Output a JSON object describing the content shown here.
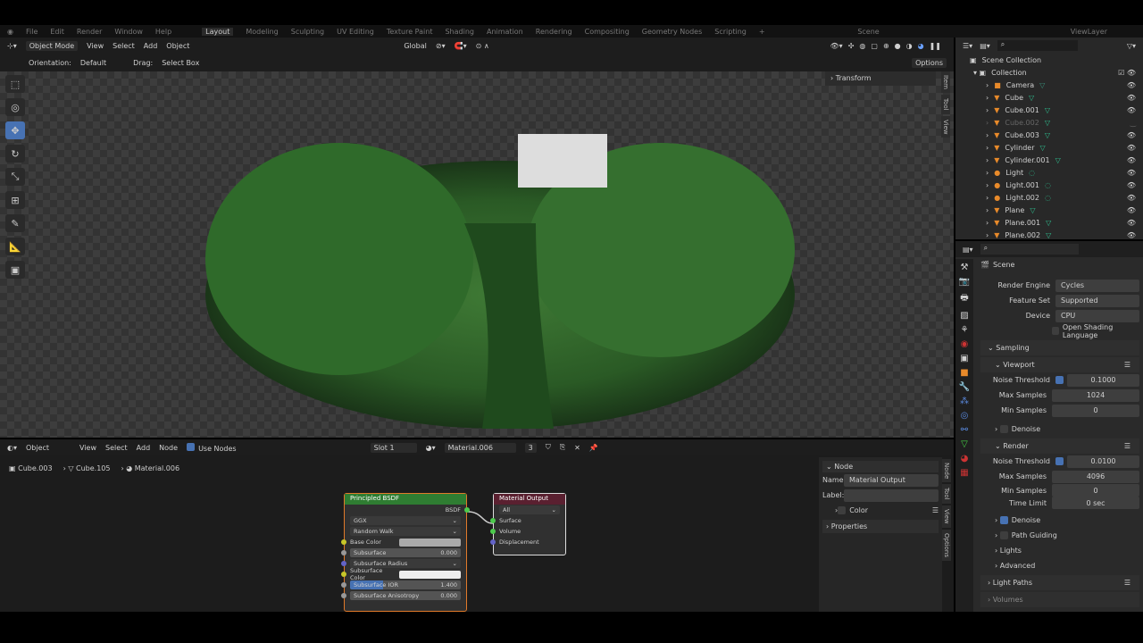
{
  "menu": [
    "File",
    "Edit",
    "Render",
    "Window",
    "Help"
  ],
  "workspaces": [
    "Layout",
    "Modeling",
    "Sculpting",
    "UV Editing",
    "Texture Paint",
    "Shading",
    "Animation",
    "Rendering",
    "Compositing",
    "Geometry Nodes",
    "Scripting"
  ],
  "scene": "Scene",
  "view_layer": "ViewLayer",
  "viewport_header": {
    "mode": "Object Mode",
    "view": "View",
    "select": "Select",
    "add": "Add",
    "object": "Object",
    "transform": "Global",
    "options": "Options"
  },
  "tool_settings": {
    "orientation_label": "Orientation:",
    "orientation": "Default",
    "drag_label": "Drag:",
    "drag": "Select Box"
  },
  "n_panel": {
    "transform": "Transform",
    "tabs": [
      "Item",
      "Tool",
      "View"
    ]
  },
  "node_header": {
    "editor": "Object",
    "view": "View",
    "select": "Select",
    "add": "Add",
    "node": "Node",
    "use_nodes": "Use Nodes",
    "slot": "Slot 1",
    "material": "Material.006",
    "users": "3"
  },
  "breadcrumb": [
    "Cube.003",
    "Cube.105",
    "Material.006"
  ],
  "principled": {
    "title": "Principled BSDF",
    "output": "BSDF",
    "distribution": "GGX",
    "sss_method": "Random Walk",
    "rows": [
      {
        "label": "Base Color"
      },
      {
        "label": "Subsurface",
        "value": "0.000"
      },
      {
        "label": "Subsurface Radius"
      },
      {
        "label": "Subsurface Color"
      },
      {
        "label": "Subsurface IOR",
        "value": "1.400"
      },
      {
        "label": "Subsurface Anisotropy",
        "value": "0.000"
      }
    ]
  },
  "material_output": {
    "title": "Material Output",
    "target": "All",
    "inputs": [
      "Surface",
      "Volume",
      "Displacement"
    ]
  },
  "node_side": {
    "section": "Node",
    "name_label": "Name:",
    "name": "Material Output",
    "label_label": "Label:",
    "color": "Color",
    "properties": "Properties",
    "tabs": [
      "Node",
      "Tool",
      "View",
      "Options"
    ]
  },
  "outliner": {
    "scene_collection": "Scene Collection",
    "collection": "Collection",
    "items": [
      {
        "name": "Camera",
        "type": "camera"
      },
      {
        "name": "Cube",
        "type": "mesh"
      },
      {
        "name": "Cube.001",
        "type": "mesh"
      },
      {
        "name": "Cube.002",
        "type": "mesh",
        "hidden": true
      },
      {
        "name": "Cube.003",
        "type": "mesh"
      },
      {
        "name": "Cylinder",
        "type": "mesh"
      },
      {
        "name": "Cylinder.001",
        "type": "mesh"
      },
      {
        "name": "Light",
        "type": "light"
      },
      {
        "name": "Light.001",
        "type": "light"
      },
      {
        "name": "Light.002",
        "type": "light"
      },
      {
        "name": "Plane",
        "type": "mesh"
      },
      {
        "name": "Plane.001",
        "type": "mesh"
      },
      {
        "name": "Plane.002",
        "type": "mesh"
      }
    ]
  },
  "properties": {
    "context": "Scene",
    "render_engine_label": "Render Engine",
    "render_engine": "Cycles",
    "feature_set_label": "Feature Set",
    "feature_set": "Supported",
    "device_label": "Device",
    "device": "CPU",
    "osl": "Open Shading Language",
    "sampling": "Sampling",
    "viewport": "Viewport",
    "noise_threshold_label": "Noise Threshold",
    "vp_noise": "0.1000",
    "max_samples_label": "Max Samples",
    "vp_max": "1024",
    "min_samples_label": "Min Samples",
    "vp_min": "0",
    "denoise": "Denoise",
    "render": "Render",
    "r_noise": "0.0100",
    "r_max": "4096",
    "r_min": "0",
    "time_limit_label": "Time Limit",
    "time_limit": "0 sec",
    "path_guiding": "Path Guiding",
    "lights": "Lights",
    "advanced": "Advanced",
    "light_paths": "Light Paths",
    "volumes": "Volumes"
  }
}
